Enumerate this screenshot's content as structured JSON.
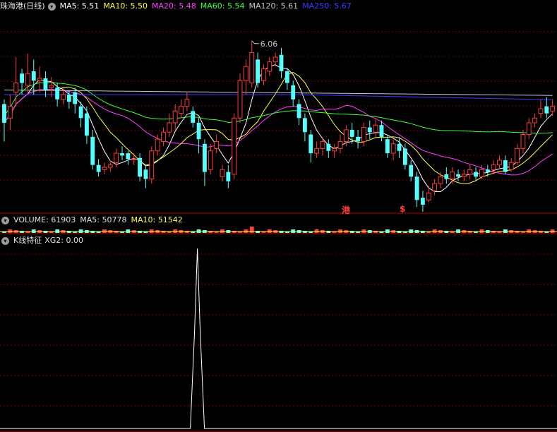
{
  "colors": {
    "up": "#ff3b3b",
    "down": "#54ffff",
    "ma5": "#ffffff",
    "ma10": "#ffff3b",
    "ma20": "#ff3bff",
    "ma60": "#3bff3b",
    "ma120": "#c8c8c8",
    "ma250": "#3b3bff",
    "grid": "#7a0000",
    "panel_line": "#b00000"
  },
  "header": {
    "stock_name": "珠海港(日线)",
    "ma5": "MA5: 5.51",
    "ma10": "MA10: 5.50",
    "ma20": "MA20: 5.48",
    "ma60": "MA60: 5.54",
    "ma120": "MA120: 5.61",
    "ma250": "MA250: 5.67"
  },
  "volume_panel": {
    "label": "VOLUME: 61903",
    "ma5": "MA5: 50778",
    "ma10": "MA10: 51542"
  },
  "indicator_panel": {
    "label": "K线特征",
    "xg2": "XG2: 0.00"
  },
  "markers": {
    "marker_1": "港",
    "marker_2": "$"
  },
  "chart_data": {
    "type": "candlestick",
    "annotation": {
      "label": "6.06",
      "value": 6.06
    },
    "price_range": [
      4.6,
      6.3
    ],
    "candles": [
      [
        5.52,
        5.36,
        5.56,
        5.2
      ],
      [
        5.4,
        5.5,
        5.6,
        5.3
      ],
      [
        5.62,
        5.7,
        5.92,
        5.5
      ],
      [
        5.78,
        5.7,
        5.82,
        5.6
      ],
      [
        5.68,
        5.78,
        5.95,
        5.62
      ],
      [
        5.8,
        5.72,
        5.9,
        5.6
      ],
      [
        5.72,
        5.74,
        5.84,
        5.62
      ],
      [
        5.74,
        5.64,
        5.8,
        5.58
      ],
      [
        5.66,
        5.68,
        5.75,
        5.58
      ],
      [
        5.66,
        5.56,
        5.7,
        5.5
      ],
      [
        5.56,
        5.6,
        5.66,
        5.52
      ],
      [
        5.6,
        5.54,
        5.64,
        5.48
      ],
      [
        5.62,
        5.52,
        5.66,
        5.44
      ],
      [
        5.5,
        5.4,
        5.54,
        5.32
      ],
      [
        5.44,
        5.25,
        5.5,
        5.18
      ],
      [
        5.24,
        5.0,
        5.3,
        4.96
      ],
      [
        5.0,
        4.94,
        5.05,
        4.9
      ],
      [
        4.96,
        4.98,
        5.02,
        4.92
      ],
      [
        4.98,
        5.0,
        5.04,
        4.94
      ],
      [
        5.02,
        5.1,
        5.14,
        4.98
      ],
      [
        5.1,
        5.08,
        5.16,
        5.04
      ],
      [
        5.1,
        5.05,
        5.12,
        5.0
      ],
      [
        5.05,
        5.05,
        5.1,
        5.0
      ],
      [
        5.06,
        4.9,
        5.1,
        4.86
      ],
      [
        4.96,
        4.88,
        5.0,
        4.8
      ],
      [
        4.88,
        5.12,
        5.16,
        4.84
      ],
      [
        5.12,
        5.22,
        5.26,
        5.08
      ],
      [
        5.2,
        5.28,
        5.32,
        5.16
      ],
      [
        5.28,
        5.36,
        5.44,
        5.24
      ],
      [
        5.36,
        5.46,
        5.52,
        5.3
      ],
      [
        5.44,
        5.5,
        5.56,
        5.4
      ],
      [
        5.5,
        5.56,
        5.62,
        5.46
      ],
      [
        5.46,
        5.36,
        5.5,
        5.32
      ],
      [
        5.36,
        5.22,
        5.4,
        5.1
      ],
      [
        5.18,
        4.94,
        5.22,
        4.82
      ],
      [
        4.96,
        5.12,
        5.18,
        4.92
      ],
      [
        5.14,
        5.2,
        5.26,
        5.1
      ],
      [
        4.9,
        4.96,
        5.0,
        4.86
      ],
      [
        4.94,
        4.86,
        5.0,
        4.8
      ],
      [
        4.92,
        5.4,
        5.44,
        4.88
      ],
      [
        5.4,
        5.72,
        5.78,
        5.36
      ],
      [
        5.72,
        5.84,
        5.9,
        5.6
      ],
      [
        5.7,
        5.96,
        6.06,
        5.66
      ],
      [
        5.9,
        5.7,
        5.96,
        5.66
      ],
      [
        5.72,
        5.82,
        5.86,
        5.68
      ],
      [
        5.8,
        5.88,
        5.92,
        5.76
      ],
      [
        5.88,
        5.92,
        5.96,
        5.84
      ],
      [
        5.94,
        5.8,
        6.0,
        5.74
      ],
      [
        5.8,
        5.7,
        5.82,
        5.64
      ],
      [
        5.68,
        5.56,
        5.72,
        5.5
      ],
      [
        5.52,
        5.4,
        5.56,
        5.34
      ],
      [
        5.4,
        5.28,
        5.44,
        5.2
      ],
      [
        5.26,
        5.1,
        5.3,
        5.02
      ],
      [
        5.1,
        5.14,
        5.2,
        5.06
      ],
      [
        5.14,
        5.2,
        5.24,
        5.08
      ],
      [
        5.18,
        5.12,
        5.22,
        5.06
      ],
      [
        5.12,
        5.14,
        5.18,
        5.06
      ],
      [
        5.14,
        5.2,
        5.26,
        5.1
      ],
      [
        5.2,
        5.3,
        5.34,
        5.16
      ],
      [
        5.3,
        5.24,
        5.36,
        5.18
      ],
      [
        5.24,
        5.2,
        5.3,
        5.14
      ],
      [
        5.2,
        5.32,
        5.36,
        5.16
      ],
      [
        5.32,
        5.28,
        5.38,
        5.22
      ],
      [
        5.28,
        5.34,
        5.4,
        5.24
      ],
      [
        5.34,
        5.24,
        5.38,
        5.2
      ],
      [
        5.22,
        5.1,
        5.26,
        5.06
      ],
      [
        5.1,
        5.18,
        5.22,
        5.04
      ],
      [
        5.18,
        5.12,
        5.24,
        5.06
      ],
      [
        5.14,
        5.0,
        5.18,
        4.96
      ],
      [
        5.0,
        4.9,
        5.04,
        4.86
      ],
      [
        4.9,
        4.7,
        4.94,
        4.64
      ],
      [
        4.72,
        4.66,
        4.78,
        4.6
      ],
      [
        4.7,
        4.76,
        4.82,
        4.68
      ],
      [
        4.78,
        4.84,
        4.88,
        4.74
      ],
      [
        4.84,
        4.9,
        4.94,
        4.8
      ],
      [
        4.92,
        4.88,
        4.98,
        4.84
      ],
      [
        4.88,
        4.94,
        4.98,
        4.84
      ],
      [
        4.92,
        4.9,
        4.96,
        4.86
      ],
      [
        4.9,
        4.92,
        4.96,
        4.86
      ],
      [
        4.92,
        4.96,
        5.0,
        4.88
      ],
      [
        4.94,
        4.9,
        4.98,
        4.86
      ],
      [
        4.9,
        4.96,
        5.0,
        4.88
      ],
      [
        4.96,
        4.94,
        5.0,
        4.9
      ],
      [
        4.96,
        5.0,
        5.04,
        4.92
      ],
      [
        5.0,
        5.04,
        5.08,
        4.96
      ],
      [
        5.04,
        4.94,
        5.08,
        4.92
      ],
      [
        4.96,
        5.02,
        5.06,
        4.94
      ],
      [
        5.02,
        5.14,
        5.18,
        5.0
      ],
      [
        5.14,
        5.26,
        5.3,
        5.1
      ],
      [
        5.26,
        5.36,
        5.4,
        5.22
      ],
      [
        5.36,
        5.4,
        5.44,
        5.32
      ],
      [
        5.44,
        5.48,
        5.56,
        5.4
      ],
      [
        5.5,
        5.44,
        5.58,
        5.4
      ],
      [
        5.46,
        5.5,
        5.56,
        5.42
      ]
    ],
    "xg2_signal": {
      "value": 0.0,
      "spike_index": 33
    }
  }
}
